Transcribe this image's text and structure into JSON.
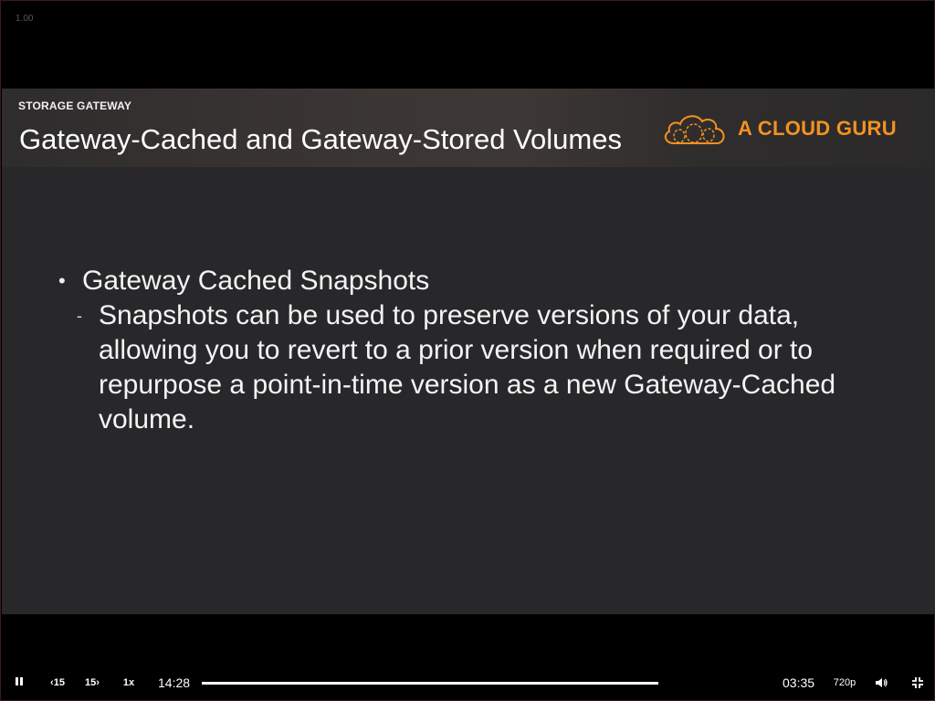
{
  "player": {
    "speed_overlay": "1.00",
    "controls": {
      "pause_icon": "pause-icon",
      "skip_back_label": "‹15",
      "skip_forward_label": "15›",
      "playback_rate": "1x",
      "elapsed_time": "14:28",
      "remaining_time": "03:35",
      "quality": "720p",
      "volume_icon": "volume-icon",
      "exit_fullscreen_icon": "exit-fullscreen-icon",
      "progress": 1.0
    }
  },
  "slide": {
    "kicker": "STORAGE GATEWAY",
    "title": "Gateway-Cached and Gateway-Stored Volumes",
    "logo_text": "A CLOUD GURU",
    "brand_color": "#f39221",
    "bullets": [
      {
        "text": "Gateway Cached Snapshots",
        "sub": [
          "Snapshots can be used to preserve versions of your data, allowing you to revert to a prior version when required or to repurpose a point-in-time version as a new Gateway-Cached volume."
        ]
      }
    ]
  }
}
